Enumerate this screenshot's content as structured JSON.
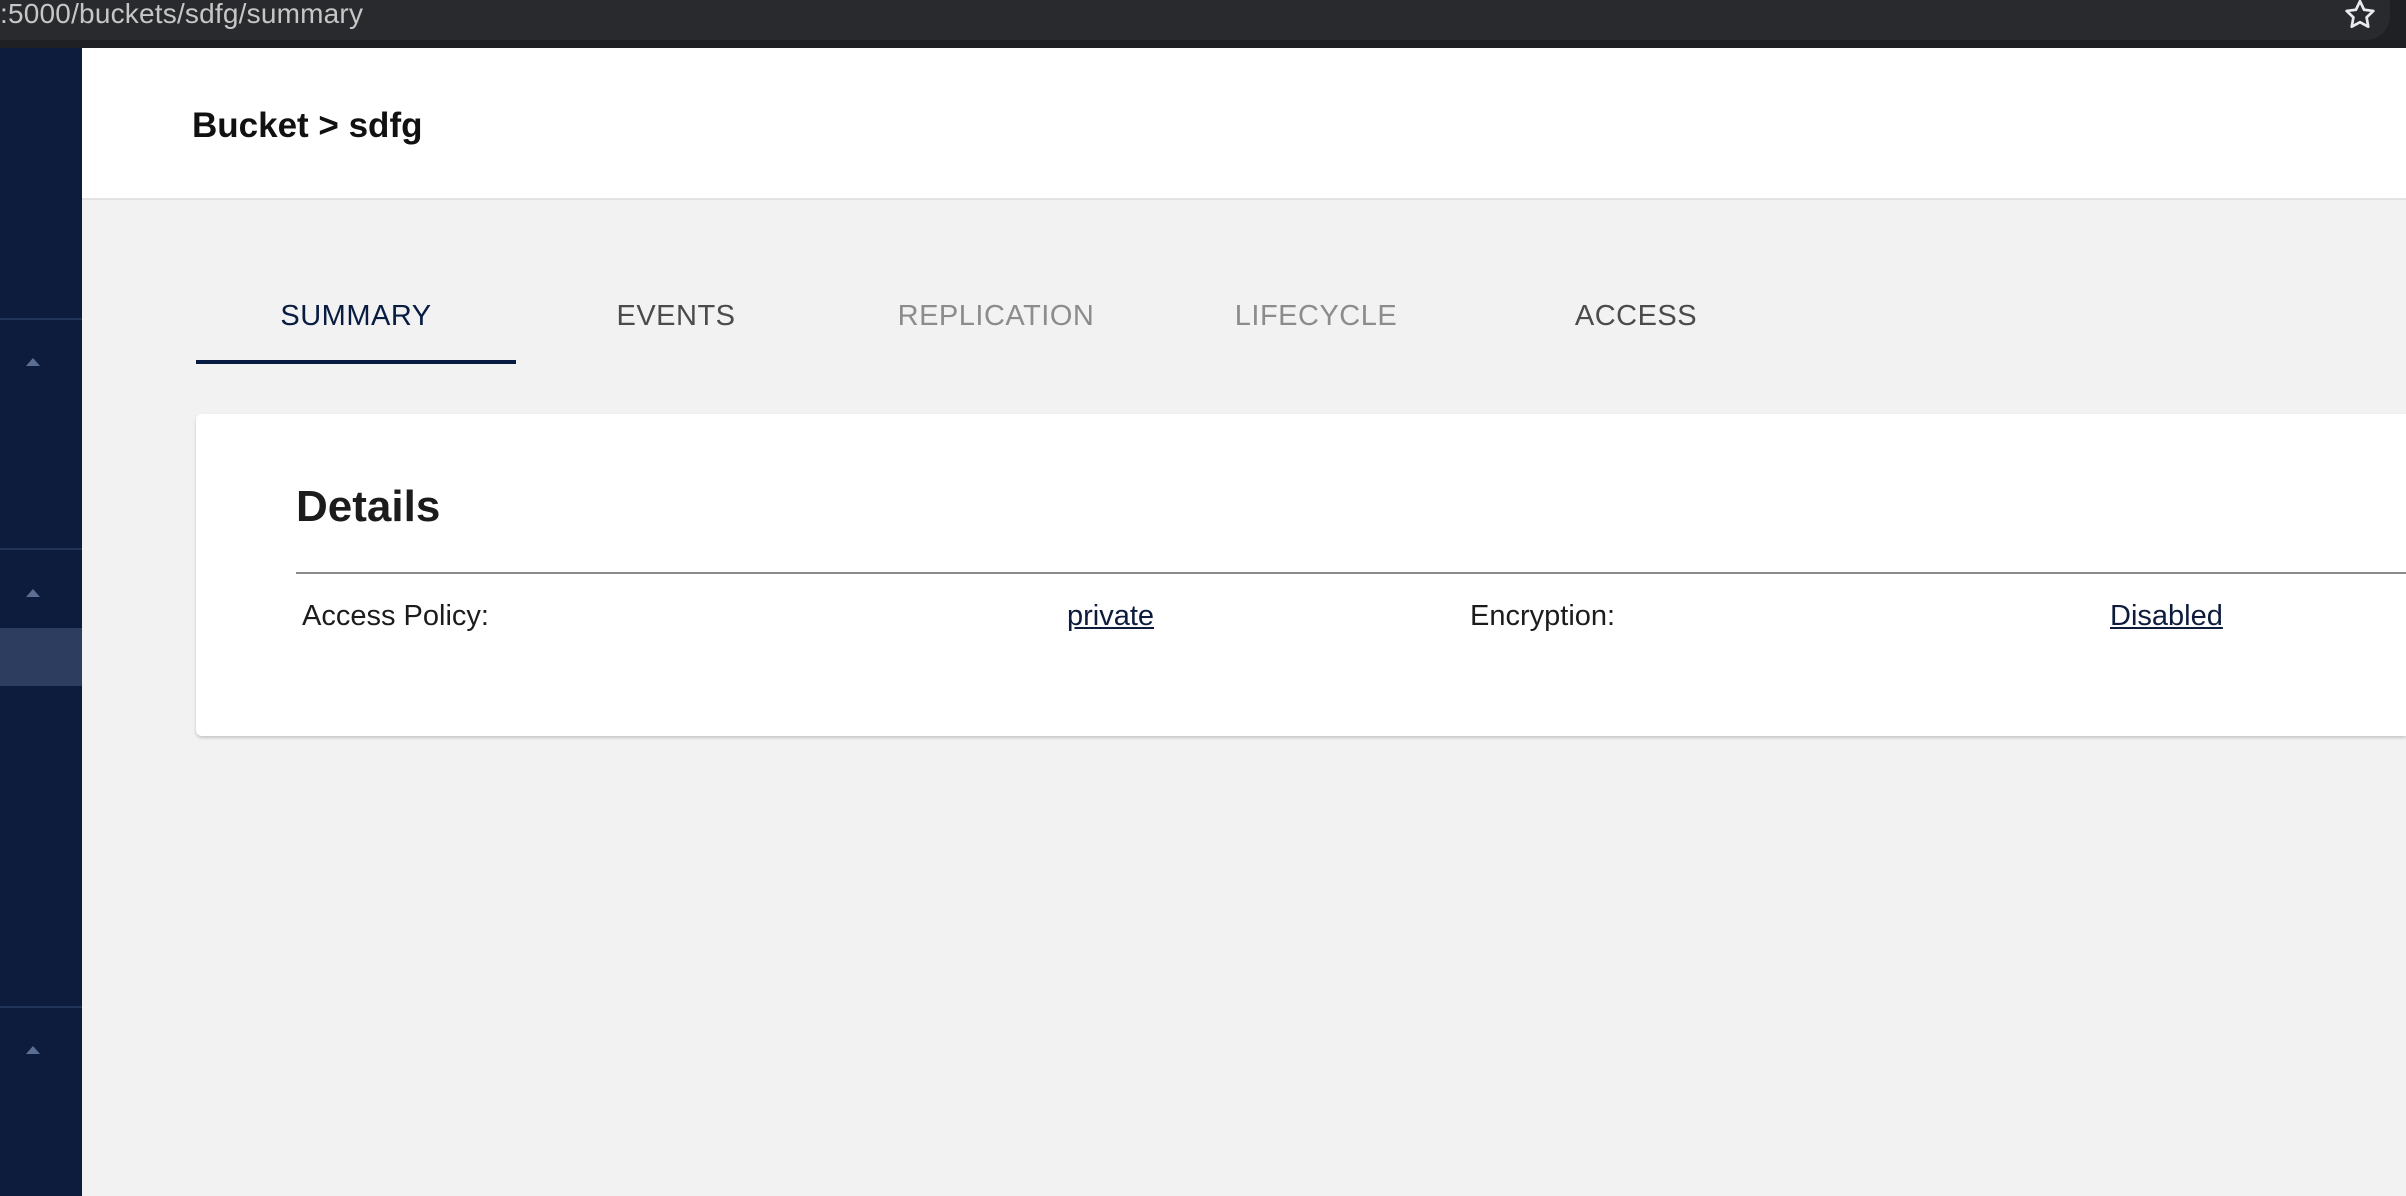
{
  "browser": {
    "url": ":5000/buckets/sdfg/summary",
    "bookmark_icon": "star-icon"
  },
  "sidebar": {
    "icons": [
      "caret-up-icon",
      "caret-up-icon",
      "caret-up-icon"
    ]
  },
  "header": {
    "breadcrumb": "Bucket > sdfg"
  },
  "tabs": [
    {
      "label": "SUMMARY",
      "active": true
    },
    {
      "label": "EVENTS",
      "active": false
    },
    {
      "label": "REPLICATION",
      "active": false
    },
    {
      "label": "LIFECYCLE",
      "active": false
    },
    {
      "label": "ACCESS",
      "active": false
    }
  ],
  "details": {
    "title": "Details",
    "access_policy_label": "Access Policy:",
    "access_policy_value": "private",
    "encryption_label": "Encryption:",
    "encryption_value": "Disabled"
  },
  "colors": {
    "sidebar": "#0d1c3c",
    "accent": "#081c42",
    "background": "#f2f2f2"
  }
}
